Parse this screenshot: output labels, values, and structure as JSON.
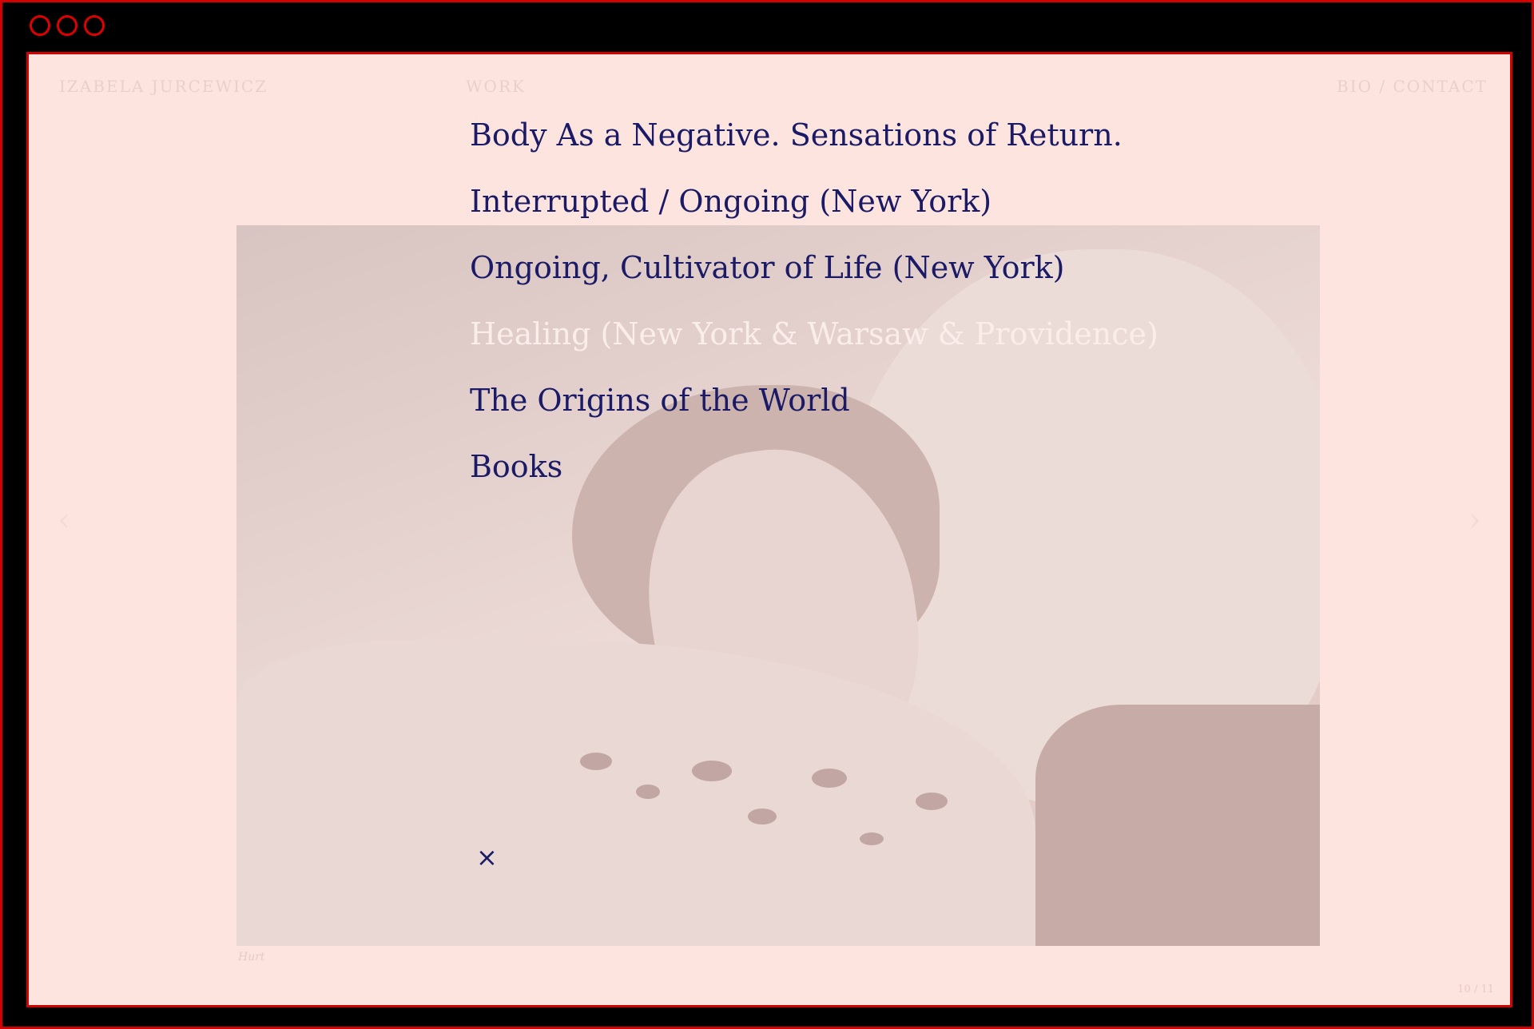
{
  "site": {
    "name": "IZABELA JURCEWICZ",
    "nav_work": "WORK",
    "nav_bio_contact": "BIO / CONTACT"
  },
  "menu": {
    "items": [
      {
        "label": "Body As a Negative. Sensations of Return."
      },
      {
        "label": "Interrupted / Ongoing (New York)"
      },
      {
        "label": "Ongoing, Cultivator of Life (New York)"
      },
      {
        "label": "Healing (New York & Warsaw & Providence)"
      },
      {
        "label": "The Origins of the World"
      },
      {
        "label": "Books"
      }
    ],
    "active_index": 3,
    "close_label": "×"
  },
  "slide": {
    "caption": "Hurt",
    "counter": "10 / 11",
    "prev_arrow": "‹",
    "next_arrow": "›"
  },
  "colors": {
    "background": "#fde4de",
    "menu_text": "#1a1a66",
    "menu_active": "#fbeeea",
    "frame": "#d40000"
  }
}
